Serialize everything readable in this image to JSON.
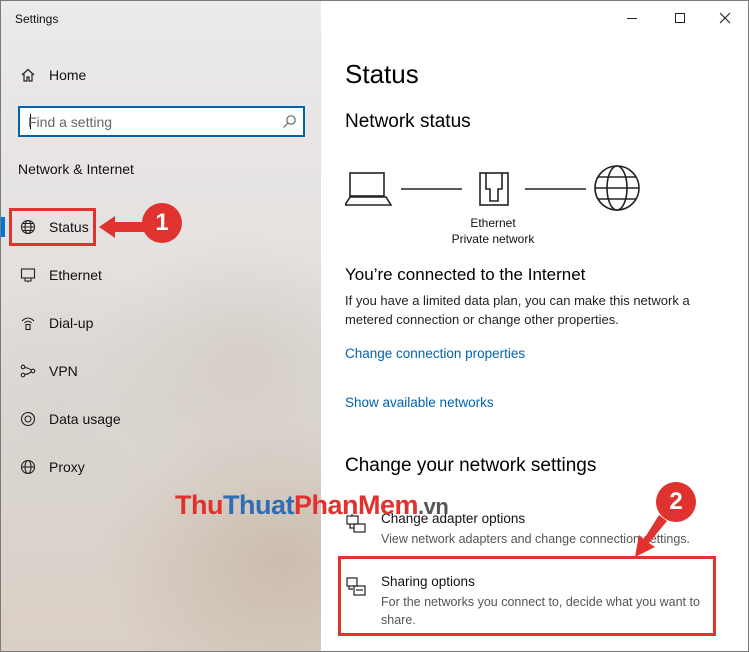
{
  "window": {
    "title": "Settings"
  },
  "sidebar": {
    "home_label": "Home",
    "search_placeholder": "Find a setting",
    "section_title": "Network & Internet",
    "items": [
      {
        "label": "Status",
        "icon": "globe-icon",
        "selected": true
      },
      {
        "label": "Ethernet",
        "icon": "ethernet-icon"
      },
      {
        "label": "Dial-up",
        "icon": "dialup-icon"
      },
      {
        "label": "VPN",
        "icon": "vpn-icon"
      },
      {
        "label": "Data usage",
        "icon": "data-usage-icon"
      },
      {
        "label": "Proxy",
        "icon": "globe-icon"
      }
    ]
  },
  "main": {
    "page_title": "Status",
    "network_status_heading": "Network status",
    "diagram": {
      "adapter_name": "Ethernet",
      "network_type": "Private network"
    },
    "connected_heading": "You’re connected to the Internet",
    "connected_description": "If you have a limited data plan, you can make this network a metered connection or change other properties.",
    "link_change_properties": "Change connection properties",
    "link_show_networks": "Show available networks",
    "change_settings_heading": "Change your network settings",
    "options": [
      {
        "title": "Change adapter options",
        "description": "View network adapters and change connection settings."
      },
      {
        "title": "Sharing options",
        "description": "For the networks you connect to, decide what you want to share."
      }
    ]
  },
  "annotations": {
    "badge_1": "1",
    "badge_2": "2",
    "watermark": {
      "part1": "Thu",
      "part2": "Thuat",
      "part3": "PhanMem",
      "part4": ".vn"
    }
  },
  "colors": {
    "accent": "#0078d7",
    "link": "#0063b1",
    "highlight": "#e0322f"
  }
}
